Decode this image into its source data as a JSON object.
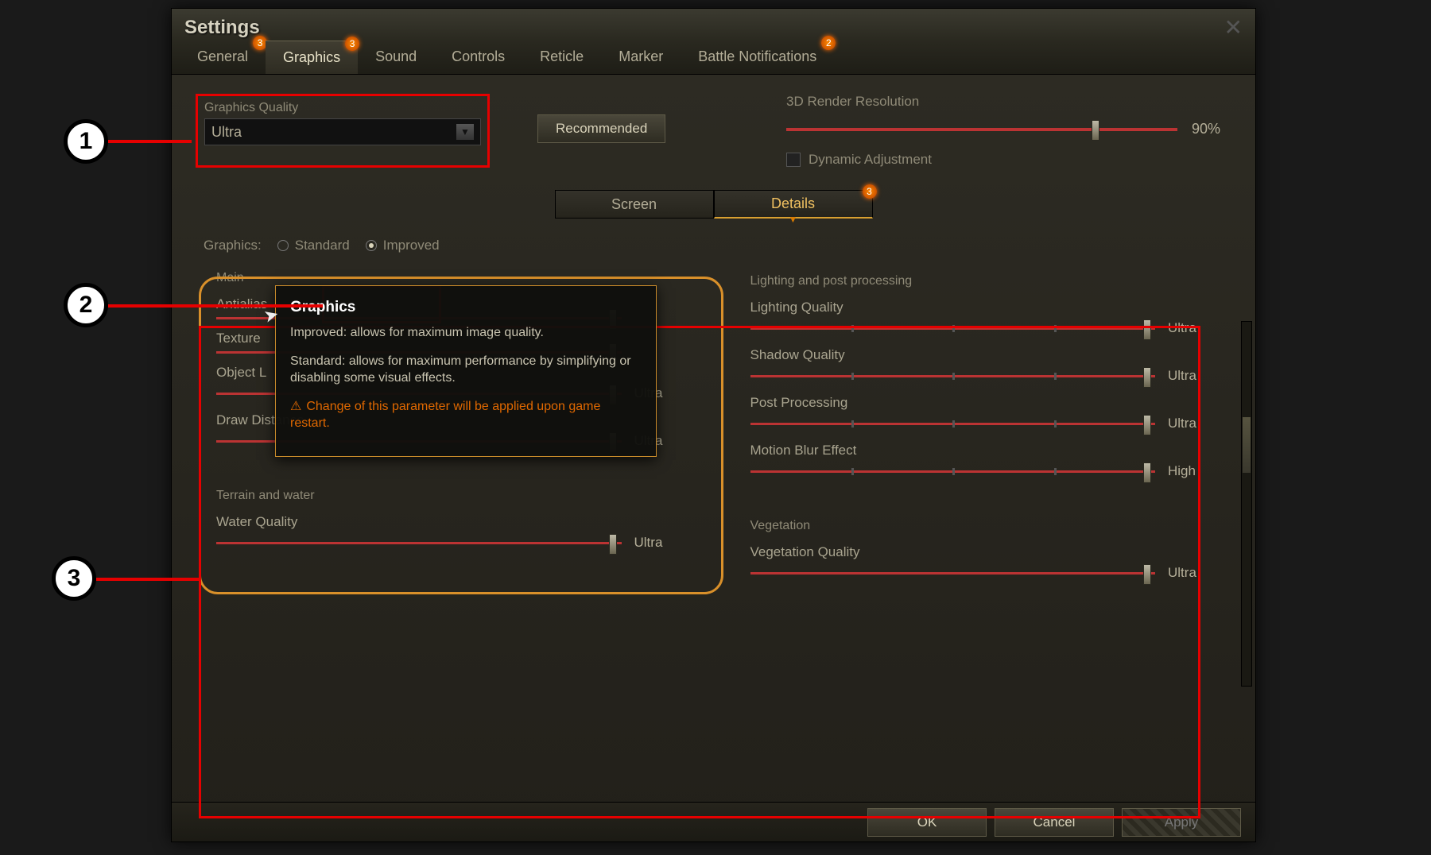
{
  "window": {
    "title": "Settings"
  },
  "tabs": {
    "general": "General",
    "graphics": "Graphics",
    "sound": "Sound",
    "controls": "Controls",
    "reticle": "Reticle",
    "marker": "Marker",
    "battle_notifications": "Battle Notifications",
    "badge_general": "3",
    "badge_graphics": "3",
    "badge_notifications": "2"
  },
  "graphics_quality": {
    "label": "Graphics Quality",
    "value": "Ultra",
    "recommended_btn": "Recommended"
  },
  "render": {
    "label": "3D Render Resolution",
    "value": "90%",
    "dynamic_label": "Dynamic Adjustment"
  },
  "subtabs": {
    "screen": "Screen",
    "details": "Details",
    "badge_details": "3"
  },
  "mode": {
    "label": "Graphics:",
    "standard": "Standard",
    "improved": "Improved"
  },
  "sections": {
    "main": "Main",
    "lighting": "Lighting and post processing",
    "terrain": "Terrain and water",
    "vegetation": "Vegetation"
  },
  "settings": {
    "antialias": {
      "label": "Antialias",
      "value": ""
    },
    "texture": {
      "label": "Texture",
      "value": ""
    },
    "object": {
      "label": "Object L",
      "value": "Ultra"
    },
    "draw": {
      "label": "Draw Distance",
      "value": "Ultra"
    },
    "water": {
      "label": "Water Quality",
      "value": "Ultra"
    },
    "lighting": {
      "label": "Lighting Quality",
      "value": "Ultra"
    },
    "shadow": {
      "label": "Shadow Quality",
      "value": "Ultra"
    },
    "post": {
      "label": "Post Processing",
      "value": "Ultra"
    },
    "motion": {
      "label": "Motion Blur Effect",
      "value": "High"
    },
    "vegetation": {
      "label": "Vegetation Quality",
      "value": "Ultra"
    }
  },
  "tooltip": {
    "title": "Graphics",
    "line1": "Improved: allows for maximum image quality.",
    "line2": "Standard: allows for maximum performance by simplifying or disabling some visual effects.",
    "warning": "Change of this parameter will be applied upon game restart."
  },
  "footer": {
    "ok": "OK",
    "cancel": "Cancel",
    "apply": "Apply"
  },
  "callouts": {
    "c1": "1",
    "c2": "2",
    "c3": "3"
  }
}
